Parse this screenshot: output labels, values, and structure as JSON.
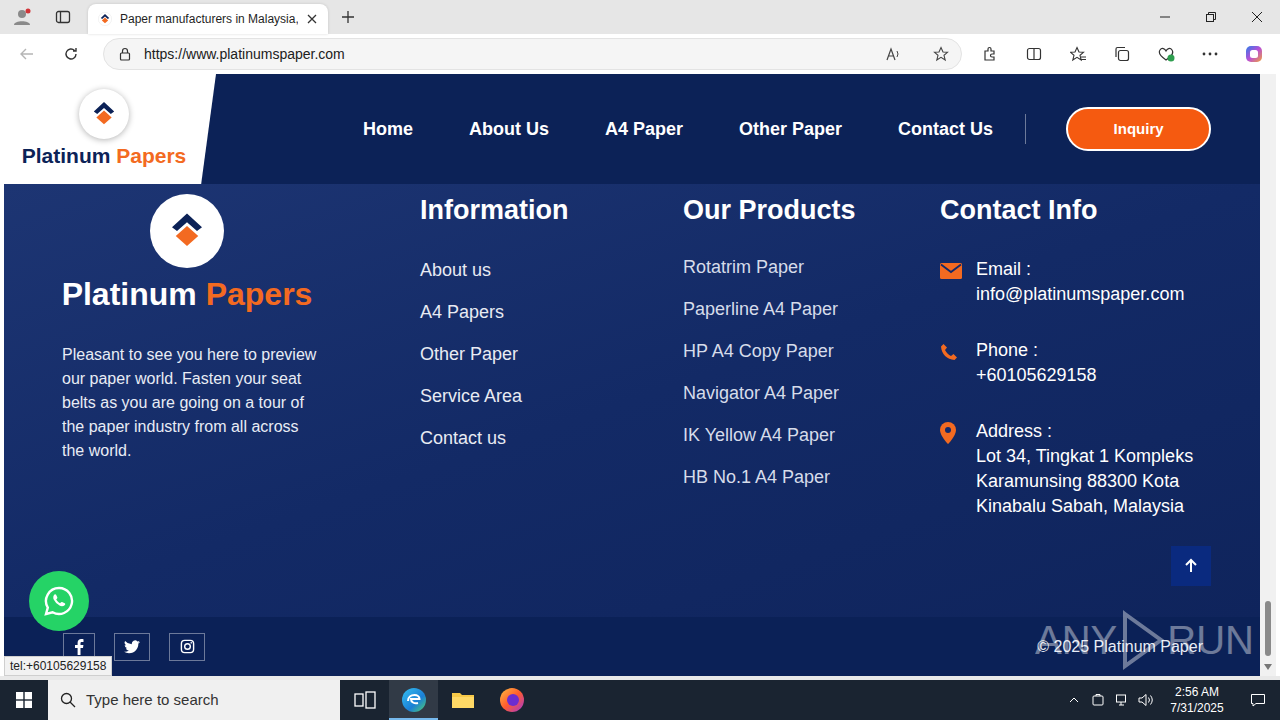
{
  "browser": {
    "tab": {
      "title": "Paper manufacturers in Malaysia,",
      "selected": true
    },
    "url": "https://www.platinumspaper.com",
    "status_link": "tel:+60105629158"
  },
  "header": {
    "logo": {
      "first": "Platinum",
      "second": "Papers"
    },
    "nav": [
      "Home",
      "About Us",
      "A4 Paper",
      "Other Paper",
      "Contact Us"
    ],
    "inquiry": "Inquiry"
  },
  "footer": {
    "logo": {
      "first": "Platinum",
      "second": "Papers"
    },
    "about": "Pleasant to see you here to preview our paper world. Fasten your seat belts as you are going on a tour of the paper industry from all across the world.",
    "information": {
      "heading": "Information",
      "links": [
        "About us",
        "A4 Papers",
        "Other Paper",
        "Service Area",
        "Contact us"
      ]
    },
    "products": {
      "heading": "Our Products",
      "items": [
        "Rotatrim Paper",
        "Paperline A4 Paper",
        "HP A4 Copy Paper",
        "Navigator A4 Paper",
        "IK Yellow A4 Paper",
        "HB No.1 A4 Paper"
      ]
    },
    "contact": {
      "heading": "Contact Info",
      "items": [
        {
          "kind": "email",
          "label": "Email :",
          "value": "info@platinumspaper.com"
        },
        {
          "kind": "phone",
          "label": "Phone :",
          "value": "+60105629158"
        },
        {
          "kind": "address",
          "label": "Address :",
          "value": "Lot 34, Tingkat 1 Kompleks Karamunsing 88300 Kota Kinabalu Sabah, Malaysia"
        }
      ]
    },
    "copyright": "© 2025 Platinum Paper"
  },
  "watermark": {
    "first": "ANY",
    "second": "RUN"
  },
  "taskbar": {
    "search": "Type here to search",
    "apps": [
      {
        "kind": "task-view",
        "active": false
      },
      {
        "kind": "edge",
        "active": true
      },
      {
        "kind": "explorer",
        "active": false
      },
      {
        "kind": "firefox",
        "active": false
      }
    ],
    "time": "2:56 AM",
    "date": "7/31/2025"
  }
}
